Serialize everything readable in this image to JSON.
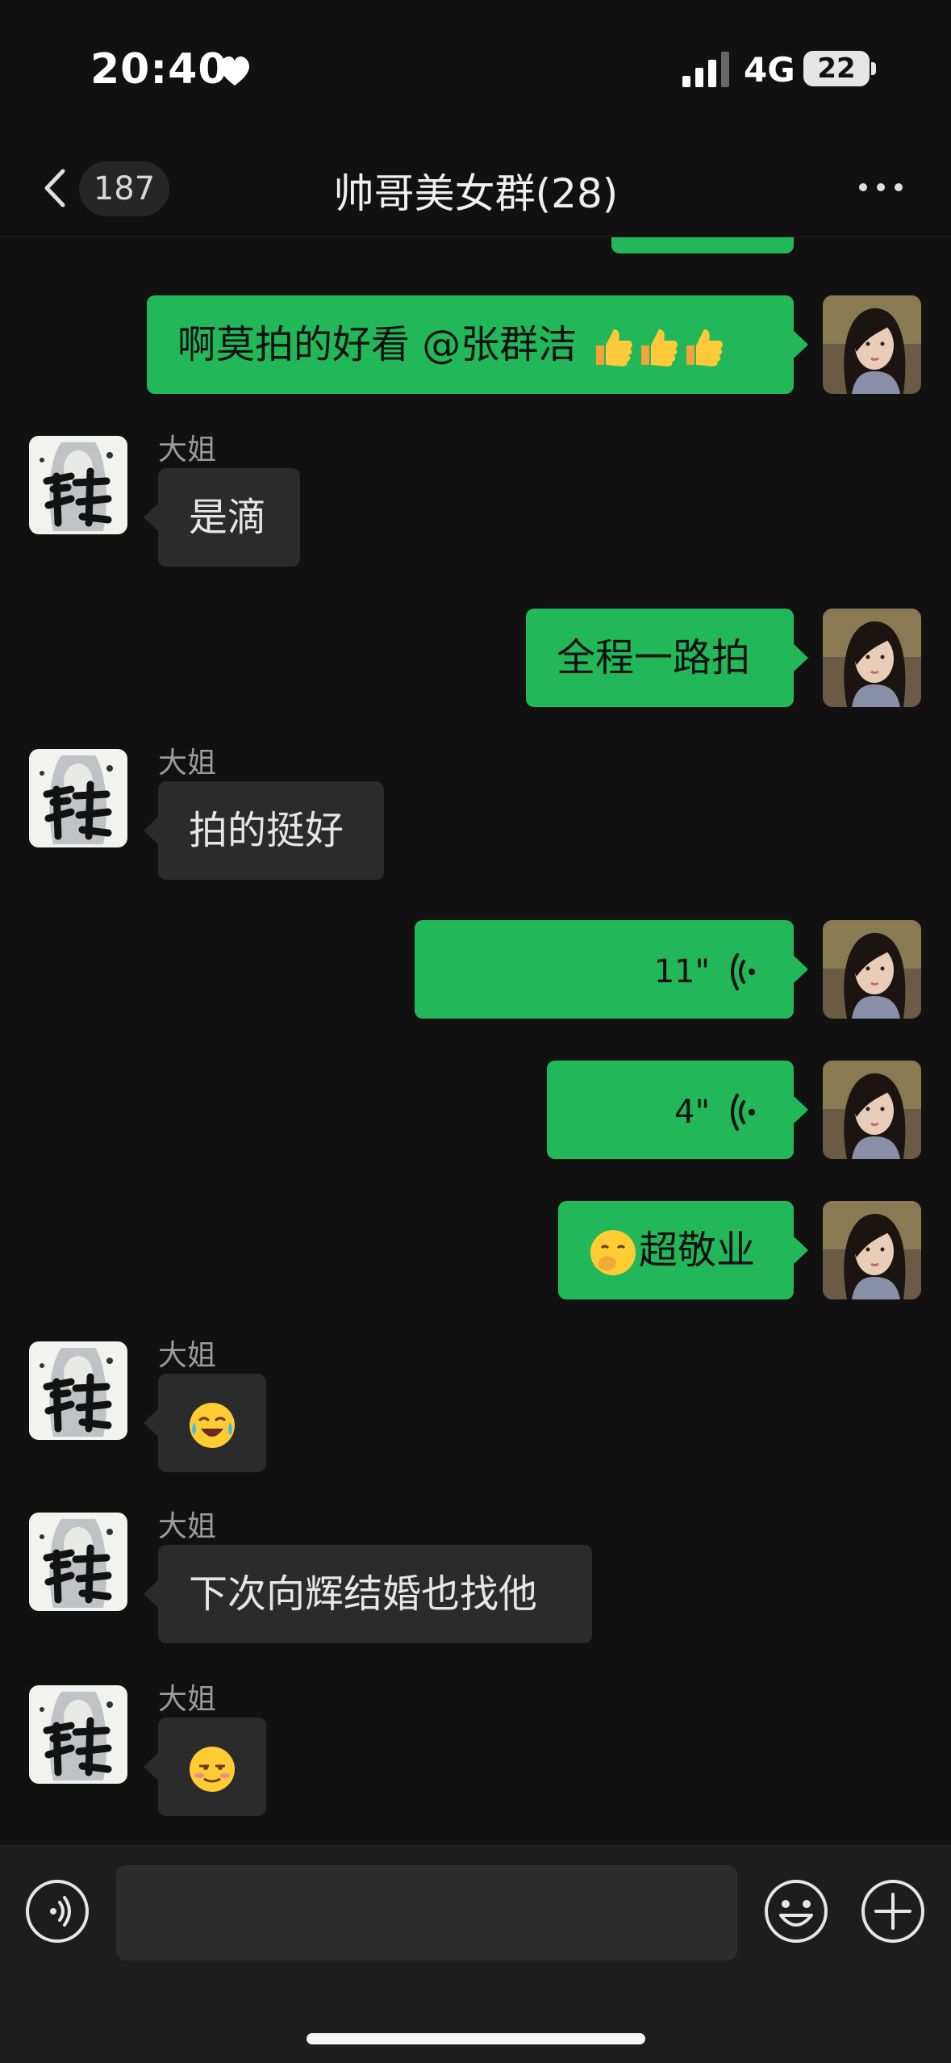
{
  "status_bar": {
    "time": "20:40",
    "network": "4G",
    "battery": "22"
  },
  "nav": {
    "unread_count": "187",
    "title": "帅哥美女群(28)"
  },
  "messages": [
    {
      "side": "right",
      "text": "啊莫拍的好看 @张群洁 ",
      "emojis": [
        "thumbs-up",
        "thumbs-up",
        "thumbs-up"
      ]
    },
    {
      "side": "left",
      "sender": "大姐",
      "text": "是滴"
    },
    {
      "side": "right",
      "text": "全程一路拍"
    },
    {
      "side": "left",
      "sender": "大姐",
      "text": "拍的挺好"
    },
    {
      "side": "right",
      "type": "voice",
      "duration": "11\""
    },
    {
      "side": "right",
      "type": "voice",
      "duration": "4\""
    },
    {
      "side": "right",
      "text": "超敬业",
      "emojis": [
        "face-with-hand-over-mouth"
      ]
    },
    {
      "side": "left",
      "sender": "大姐",
      "emojis": [
        "tears-of-joy"
      ]
    },
    {
      "side": "left",
      "sender": "大姐",
      "text": "下次向辉结婚也找他"
    },
    {
      "side": "left",
      "sender": "大姐",
      "emojis": [
        "smirk-blush"
      ]
    }
  ],
  "input_bar": {
    "placeholder": ""
  },
  "colors": {
    "background": "#111111",
    "bubble_out": "#22b85a",
    "bubble_in": "#2b2b2b",
    "input_bar": "#1d1d1d"
  },
  "icons": [
    "heart-icon",
    "signal-icon",
    "battery-icon",
    "back-icon",
    "more-icon",
    "voice-wave-icon",
    "voice-input-icon",
    "emoji-icon",
    "plus-icon"
  ]
}
